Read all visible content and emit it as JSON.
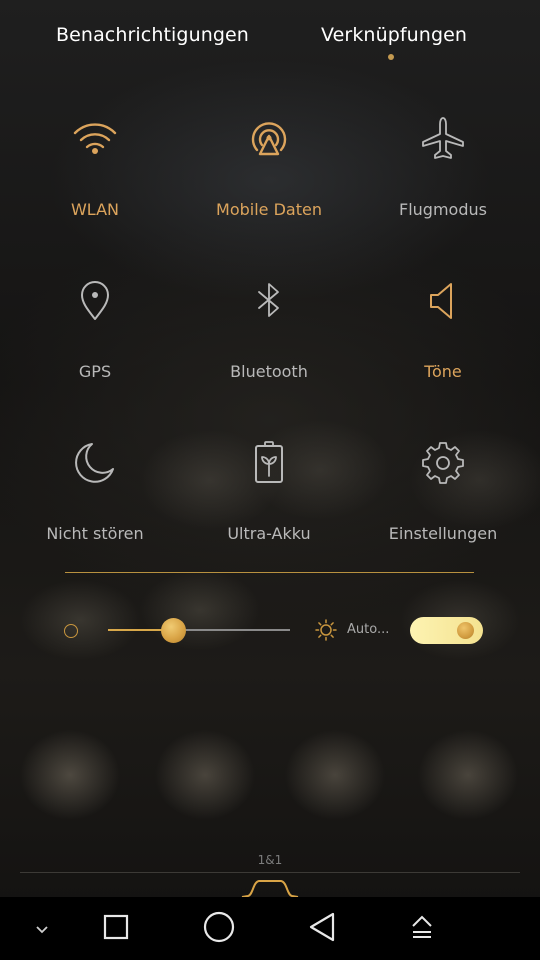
{
  "tabs": {
    "notifications": "Benachrichtigungen",
    "shortcuts": "Verknüpfungen",
    "active": "shortcuts"
  },
  "tiles": [
    {
      "label": "WLAN",
      "icon": "wifi-icon",
      "state": "on"
    },
    {
      "label": "Mobile Daten",
      "icon": "mobile-data-icon",
      "state": "on"
    },
    {
      "label": "Flugmodus",
      "icon": "airplane-icon",
      "state": "off"
    },
    {
      "label": "GPS",
      "icon": "location-pin-icon",
      "state": "off"
    },
    {
      "label": "Bluetooth",
      "icon": "bluetooth-icon",
      "state": "off"
    },
    {
      "label": "Töne",
      "icon": "speaker-icon",
      "state": "on"
    },
    {
      "label": "Nicht stören",
      "icon": "moon-icon",
      "state": "off"
    },
    {
      "label": "Ultra-Akku",
      "icon": "battery-saver-icon",
      "state": "off"
    },
    {
      "label": "Einstellungen",
      "icon": "gear-icon",
      "state": "off"
    }
  ],
  "brightness": {
    "level": 0.36,
    "auto_label": "Auto...",
    "auto_enabled": true
  },
  "carrier": "1&1",
  "colors": {
    "accent": "#dca45c",
    "inactive": "#b9b9b9",
    "toggle_on": "#fdf3b2"
  }
}
